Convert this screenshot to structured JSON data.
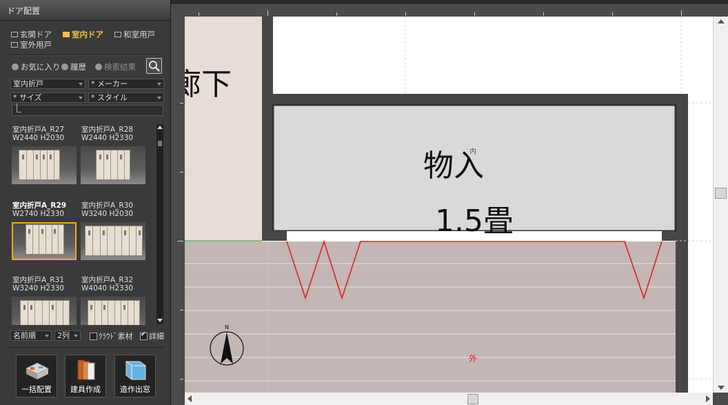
{
  "panel": {
    "title": "ドア配置",
    "categories": [
      "玄関ドア",
      "室内ドア",
      "和室用戸",
      "室外用戸"
    ],
    "tools": {
      "favorites": "お気に入り",
      "history": "履歴",
      "search_results": "検索結果"
    },
    "filters": {
      "type": "室内折戸",
      "maker": "* メーカー",
      "size": "* サイズ",
      "style": "* スタイル"
    },
    "items": [
      {
        "name": "室内折戸A_R27",
        "dims": "W2440 H2030"
      },
      {
        "name": "室内折戸A_R28",
        "dims": "W2440 H2330"
      },
      {
        "name": "室内折戸A_R29",
        "dims": "W2740 H2330"
      },
      {
        "name": "室内折戸A_R30",
        "dims": "W3240 H2030"
      },
      {
        "name": "室内折戸A_R31",
        "dims": "W3240 H2330"
      },
      {
        "name": "室内折戸A_R32",
        "dims": "W4040 H2330"
      }
    ],
    "sort": "名前順",
    "columns": "2列",
    "cloud_label": "ｸﾗｳﾄﾞ素材",
    "detail_label": "詳細",
    "buttons": {
      "bulk": "一括配置",
      "create": "建具作成",
      "window": "造作出窓"
    }
  },
  "plan": {
    "hall_label": "廊下",
    "room_name": "物入",
    "room_size": "1.5畳",
    "inside_label": "内",
    "outside_label": "外"
  },
  "colors": {
    "accent": "#f1c046",
    "selection": "#f0a821",
    "wall": "#474747",
    "room_fill": "#d9d9d9",
    "floor": "#c2b7b4",
    "hall_fill": "#e8dcd6",
    "door_swing": "#e02020"
  }
}
